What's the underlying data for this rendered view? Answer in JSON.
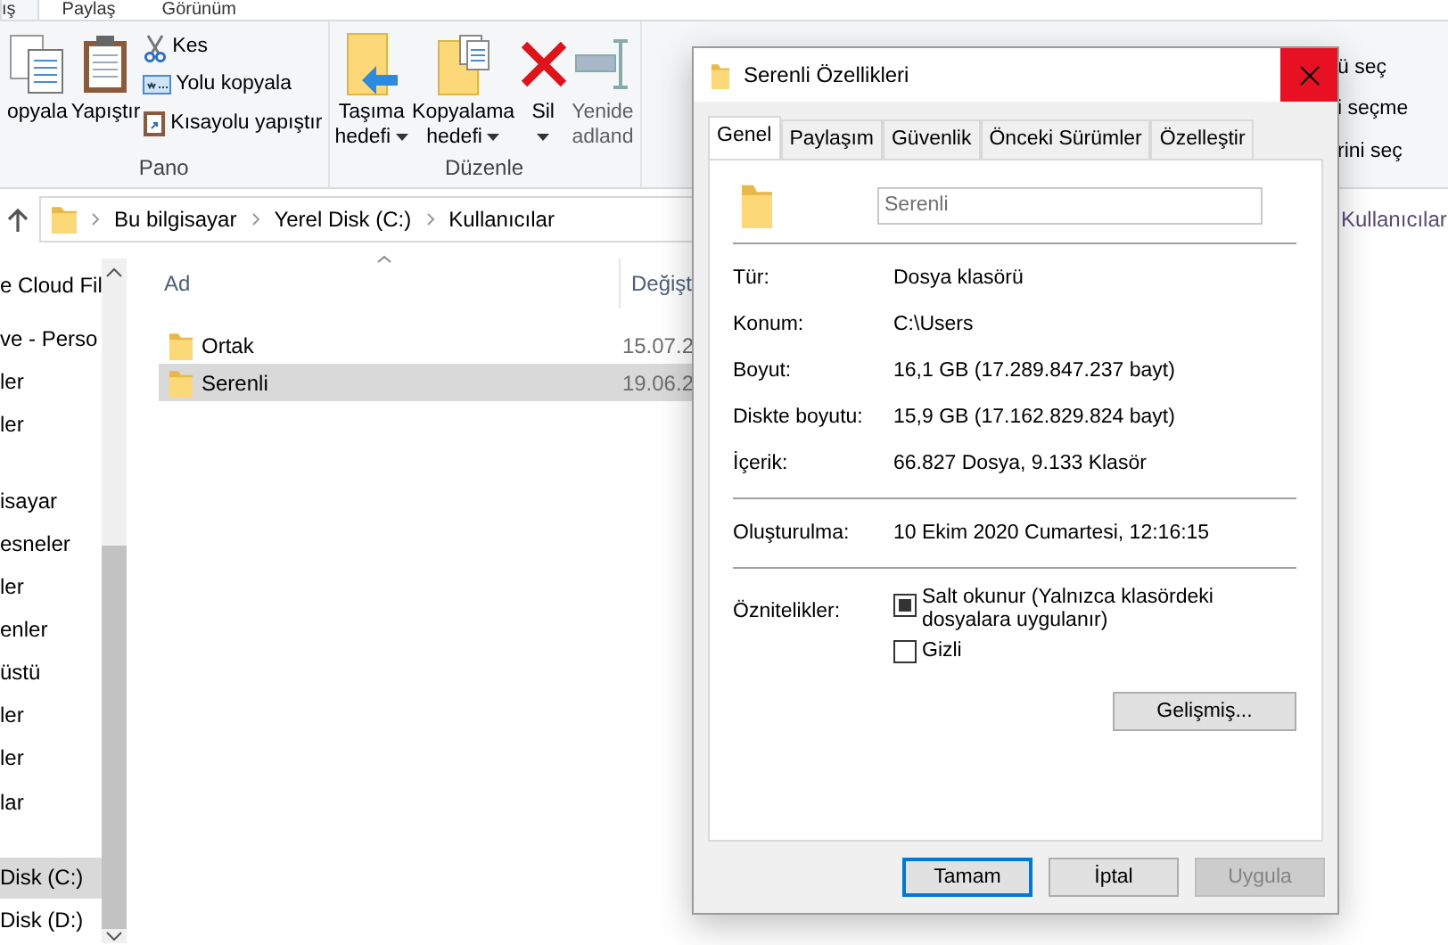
{
  "ribbon_tabs": [
    {
      "label": "ış",
      "selected": true
    },
    {
      "label": "Paylaş",
      "selected": false
    },
    {
      "label": "Görünüm",
      "selected": false
    }
  ],
  "ribbon_groups": [
    {
      "label": "Pano",
      "large_buttons": [
        {
          "lines": [
            "opyala"
          ],
          "kind": "copy",
          "dropdown": false,
          "disabled": false
        },
        {
          "lines": [
            "Yapıştır"
          ],
          "kind": "paste",
          "dropdown": false,
          "disabled": false
        }
      ],
      "small_buttons": [
        {
          "label": "Kes",
          "kind": "cut"
        },
        {
          "label": "Yolu kopyala",
          "kind": "path"
        },
        {
          "label": "Kısayolu yapıştır",
          "kind": "shortcut"
        }
      ]
    },
    {
      "label": "Düzenle",
      "large_buttons": [
        {
          "lines": [
            "Taşıma",
            "hedefi"
          ],
          "kind": "move",
          "dropdown": true,
          "disabled": false
        },
        {
          "lines": [
            "Kopyalama",
            "hedefi"
          ],
          "kind": "copyto",
          "dropdown": true,
          "disabled": false
        },
        {
          "lines": [
            "Sil"
          ],
          "kind": "delete",
          "dropdown": true,
          "disabled": false
        },
        {
          "lines": [
            "Yenide",
            "adland"
          ],
          "kind": "rename",
          "dropdown": false,
          "disabled": true
        }
      ]
    }
  ],
  "select_commands": [
    "ü seç",
    "i seçme",
    "rini seç"
  ],
  "address_bar": {
    "crumbs": [
      "Bu bilgisayar",
      "Yerel Disk (C:)",
      "Kullanıcılar"
    ]
  },
  "search_box": {
    "placeholder": "Kullanıcılar"
  },
  "nav_pane": {
    "items": [
      {
        "label": "e Cloud Fil",
        "selected": false
      },
      {
        "label": "ve - Perso",
        "selected": false
      },
      {
        "label": "ler",
        "selected": false
      },
      {
        "label": "ler",
        "selected": false
      },
      {
        "label": "isayar",
        "selected": false
      },
      {
        "label": "esneler",
        "selected": false
      },
      {
        "label": "ler",
        "selected": false
      },
      {
        "label": "enler",
        "selected": false
      },
      {
        "label": "üstü",
        "selected": false
      },
      {
        "label": "ler",
        "selected": false
      },
      {
        "label": "ler",
        "selected": false
      },
      {
        "label": "lar",
        "selected": false
      },
      {
        "label": "Disk (C:)",
        "selected": true
      },
      {
        "label": "Disk (D:)",
        "selected": false
      }
    ]
  },
  "file_list": {
    "columns": [
      "Ad",
      "Değişt"
    ],
    "rows": [
      {
        "name": "Ortak",
        "modified": "15.07.2",
        "selected": false
      },
      {
        "name": "Serenli",
        "modified": "19.06.2",
        "selected": true
      }
    ]
  },
  "dialog": {
    "title": "Serenli Özellikleri",
    "tabs": [
      {
        "label": "Genel",
        "selected": true
      },
      {
        "label": "Paylaşım",
        "selected": false
      },
      {
        "label": "Güvenlik",
        "selected": false
      },
      {
        "label": "Önceki Sürümler",
        "selected": false
      },
      {
        "label": "Özelleştir",
        "selected": false
      }
    ],
    "name_field": {
      "value": "Serenli"
    },
    "sections": [
      [
        {
          "label": "Tür:",
          "value": "Dosya klasörü"
        },
        {
          "label": "Konum:",
          "value": "C:\\Users"
        },
        {
          "label": "Boyut:",
          "value": "16,1 GB (17.289.847.237 bayt)"
        },
        {
          "label": "Diskte boyutu:",
          "value": "15,9 GB (17.162.829.824 bayt)"
        },
        {
          "label": "İçerik:",
          "value": "66.827 Dosya, 9.133 Klasör"
        }
      ],
      [
        {
          "label": "Oluşturulma:",
          "value": "10 Ekim 2020 Cumartesi, 12:16:15"
        }
      ]
    ],
    "attributes_label": "Öznitelikler:",
    "attributes": [
      {
        "label": "Salt okunur (Yalnızca klasördeki dosyalara uygulanır)",
        "checked": false,
        "indeterminate": true
      },
      {
        "label": "Gizli",
        "checked": false,
        "indeterminate": false
      }
    ],
    "advanced_button": "Gelişmiş...",
    "buttons": [
      {
        "label": "Tamam",
        "focused": true,
        "disabled": false
      },
      {
        "label": "İptal",
        "focused": false,
        "disabled": false
      },
      {
        "label": "Uygula",
        "focused": false,
        "disabled": true
      }
    ]
  }
}
